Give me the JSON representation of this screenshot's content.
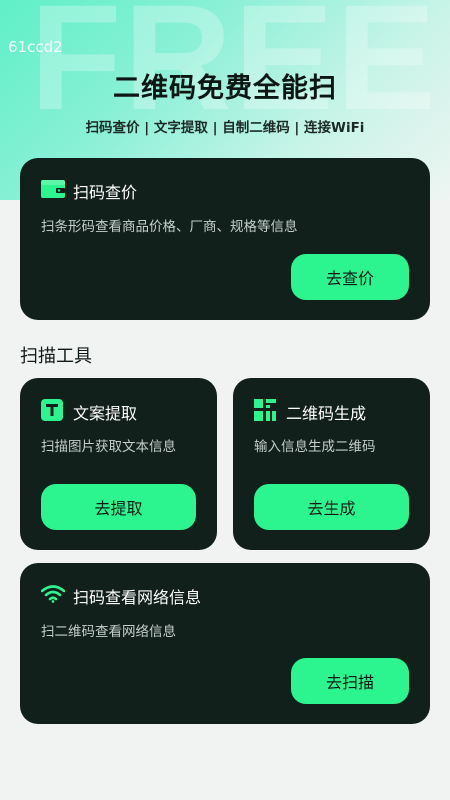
{
  "header": {
    "watermark": "FREE",
    "debug_id": "61ccd2",
    "title": "二维码免费全能扫",
    "subtitle": "扫码查价 | 文字提取 | 自制二维码 | 连接WiFi"
  },
  "scan_price_card": {
    "icon": "wallet-icon",
    "title": "扫码查价",
    "description": "扫条形码查看商品价格、厂商、规格等信息",
    "button": "去查价"
  },
  "tools_section": {
    "label": "扫描工具"
  },
  "text_extract_card": {
    "icon": "text-t-icon",
    "title": "文案提取",
    "description": "扫描图片获取文本信息",
    "button": "去提取"
  },
  "qr_generate_card": {
    "icon": "qr-grid-icon",
    "title": "二维码生成",
    "description": "输入信息生成二维码",
    "button": "去生成"
  },
  "wifi_card": {
    "icon": "wifi-icon",
    "title": "扫码查看网络信息",
    "description": "扫二维码查看网络信息",
    "button": "去扫描"
  },
  "colors": {
    "accent": "#2cf58f",
    "card_bg": "#12201b",
    "page_bg": "#f1f3f2"
  }
}
